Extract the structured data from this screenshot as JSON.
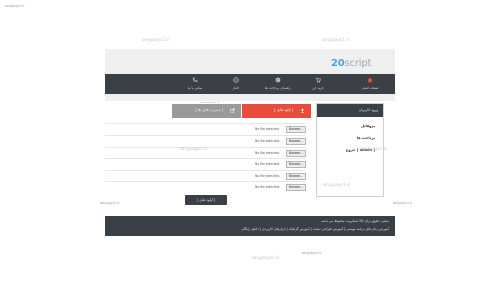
{
  "watermark": "anypaycl.ir",
  "site": {
    "logo_num": "20",
    "logo_text": "script"
  },
  "nav": [
    {
      "label": "صفحه اصلی",
      "icon": "home-icon",
      "color": "#e74c3c"
    },
    {
      "label": "خرید ارز",
      "icon": "cart-icon",
      "color": "#bfbfbf"
    },
    {
      "label": "راهنمای پرداخت ها",
      "icon": "help-icon",
      "color": "#bfbfbf"
    },
    {
      "label": "اخبار",
      "icon": "globe-icon",
      "color": "#bfbfbf"
    },
    {
      "label": "تماس با ما",
      "icon": "phone-icon",
      "color": "#bfbfbf"
    }
  ],
  "sidebar": {
    "title": "ورود کاربران",
    "links": [
      "پروفایل",
      "پرداخت ها",
      "خروج [ admin ]"
    ]
  },
  "tabs": {
    "active": "[ آپلود فایل ]",
    "inactive": "[ مدیریت فایل ها ]"
  },
  "file_rows": [
    {
      "browse": "Browse...",
      "status": "No file selected."
    },
    {
      "browse": "Browse...",
      "status": "No file selected."
    },
    {
      "browse": "Browse...",
      "status": "No file selected."
    },
    {
      "browse": "Browse...",
      "status": "No file selected."
    },
    {
      "browse": "Browse...",
      "status": "No file selected."
    },
    {
      "browse": "Browse...",
      "status": "No file selected."
    }
  ],
  "upload_button": "[ آپلود فایل ]",
  "footer": {
    "line1": "تمامی حقوق برای 20 اسکریپت محفوظ می باشد",
    "line2": "آموزش زبان های برنامه نویسی | آموزش طراحی سایت | آموزش گرافیک | ابزارهای کاربردی | دانلود رایگان"
  },
  "colors": {
    "accent": "#e74c3c",
    "dark": "#3b3f46",
    "header": "#efefef"
  }
}
